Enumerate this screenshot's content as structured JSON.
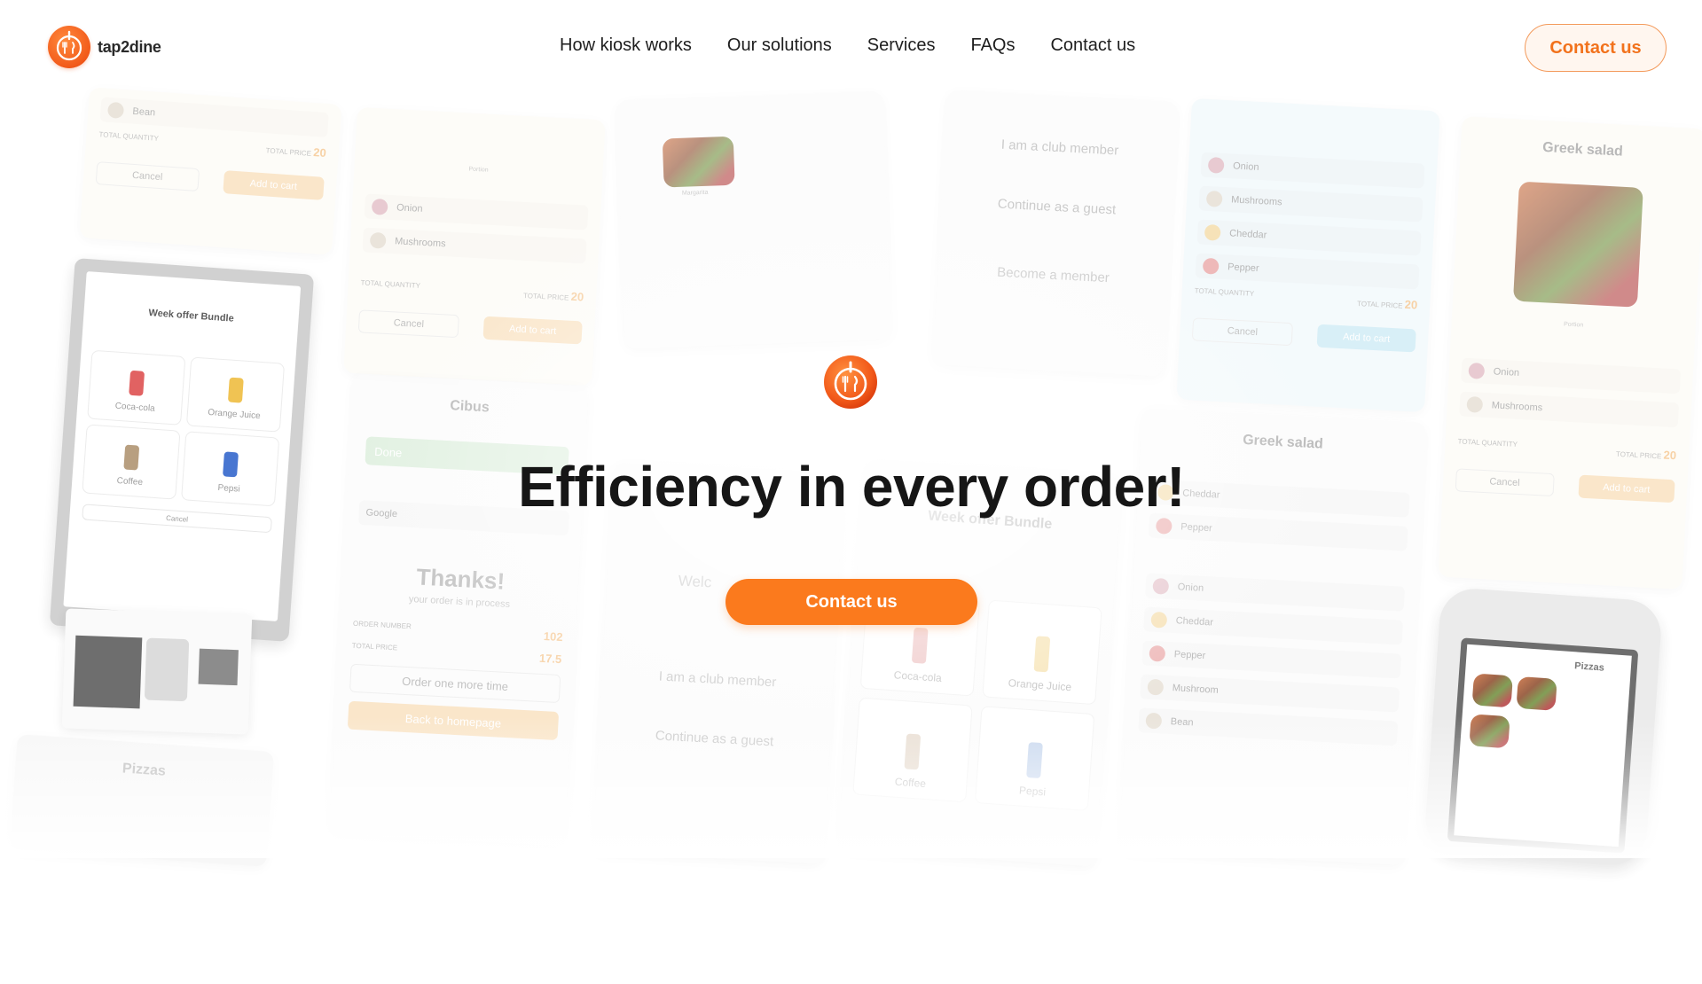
{
  "brand": {
    "name": "tap2dine",
    "accent": "#fb7a1d"
  },
  "nav": {
    "items": [
      {
        "label": "How kiosk works"
      },
      {
        "label": "Our solutions"
      },
      {
        "label": "Services"
      },
      {
        "label": "FAQs"
      },
      {
        "label": "Contact us"
      }
    ],
    "cta_label": "Contact us"
  },
  "hero": {
    "title": "Efficiency in every order!",
    "cta_label": "Contact us"
  },
  "collage": {
    "cancel": "Cancel",
    "add_to_cart": "Add to cart",
    "total_quantity": "TOTAL QUANTITY",
    "total_price": "TOTAL PRICE",
    "price_20": "20",
    "onion": "Onion",
    "mushrooms": "Mushrooms",
    "cheddar": "Cheddar",
    "pepper": "Pepper",
    "bean": "Bean",
    "mushroom": "Mushroom",
    "greek_salad": "Greek salad",
    "club_member": "I am a club member",
    "continue_guest": "Continue as a guest",
    "become_member": "Become a member",
    "cibus": "Cibus",
    "done": "Done",
    "google": "Google",
    "thanks": "Thanks!",
    "thanks_sub": "your order is in process",
    "order_number": "ORDER NUMBER",
    "order_number_value": "102",
    "total_price_value": "17.5",
    "order_again": "Order one more time",
    "back_home": "Back to homepage",
    "welcome": "Welc",
    "week_offer": "Week offer Bundle",
    "coca_cola": "Coca-cola",
    "orange_juice": "Orange Juice",
    "coffee": "Coffee",
    "pepsi": "Pepsi",
    "pizzas": "Pizzas",
    "portion": "Portion",
    "margarita": "Margarita"
  }
}
